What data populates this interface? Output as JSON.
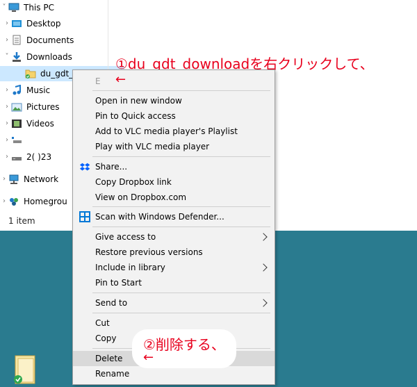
{
  "nav": {
    "items": [
      {
        "label": "This PC",
        "chevron": "v",
        "icon": "computer-icon"
      },
      {
        "label": "Desktop",
        "chevron": ">",
        "icon": "desktop-folder-icon"
      },
      {
        "label": "Documents",
        "chevron": ">",
        "icon": "documents-folder-icon"
      },
      {
        "label": "Downloads",
        "chevron": "v",
        "icon": "downloads-folder-icon"
      },
      {
        "label": "du_gdt_",
        "chevron": "",
        "icon": "folder-icon"
      },
      {
        "label": "Music",
        "chevron": ">",
        "icon": "music-folder-icon"
      },
      {
        "label": "Pictures",
        "chevron": ">",
        "icon": "pictures-folder-icon"
      },
      {
        "label": "Videos",
        "chevron": ">",
        "icon": "videos-folder-icon"
      },
      {
        "label": "",
        "chevron": ">",
        "icon": "drive-icon"
      },
      {
        "label": "2(     )23",
        "chevron": ">",
        "icon": "drive-icon"
      },
      {
        "label": "Network",
        "chevron": ">",
        "icon": "network-icon"
      },
      {
        "label": "Homegrou",
        "chevron": ">",
        "icon": "homegroup-icon"
      }
    ]
  },
  "status": {
    "count": "1 item"
  },
  "annotations": {
    "step1": "①du_gdt_downloadを右クリックして、",
    "step1_arrow": "←",
    "step2": "②削除する、",
    "step2_arrow": "←"
  },
  "context_menu": {
    "first_item_partial": "E",
    "group1": [
      "Open in new window",
      "Pin to Quick access",
      "Add to VLC media player's Playlist",
      "Play with VLC media player"
    ],
    "group2": [
      "Share...",
      "Copy Dropbox link",
      "View on Dropbox.com"
    ],
    "group3": [
      "Scan with Windows Defender..."
    ],
    "group4": [
      "Give access to",
      "Restore previous versions",
      "Include in library",
      "Pin to Start"
    ],
    "group5": [
      "Send to"
    ],
    "group6": [
      "Cut",
      "Copy"
    ],
    "group7": [
      "Delete",
      "Rename"
    ]
  },
  "colors": {
    "accent_red": "#e8001d",
    "desktop_bg": "#2a7b8f",
    "selection": "#cce8ff",
    "dropbox_blue": "#0061fe",
    "defender_blue": "#0078d7"
  }
}
